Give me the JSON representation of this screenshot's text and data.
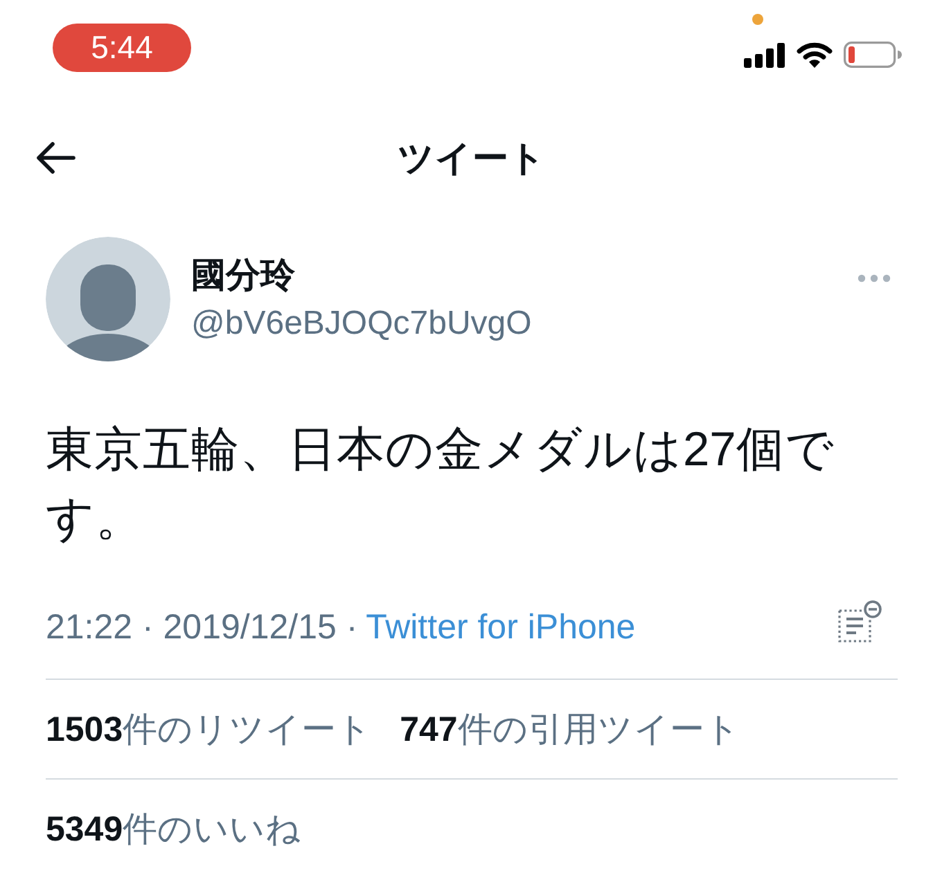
{
  "status_bar": {
    "time": "5:44"
  },
  "header": {
    "title": "ツイート"
  },
  "tweet": {
    "author": {
      "name": "國分玲",
      "handle": "@bV6eBJOQc7bUvgO"
    },
    "text": "東京五輪、日本の金メダルは27個です。",
    "timestamp": "21:22 · 2019/12/15 ·",
    "source": "Twitter for iPhone"
  },
  "stat_rows": [
    {
      "stats": [
        "**1503**件のリツイート",
        "**747**件の引用ツイート"
      ]
    },
    {
      "stats": [
        "**5349**件のいいね"
      ]
    }
  ]
}
